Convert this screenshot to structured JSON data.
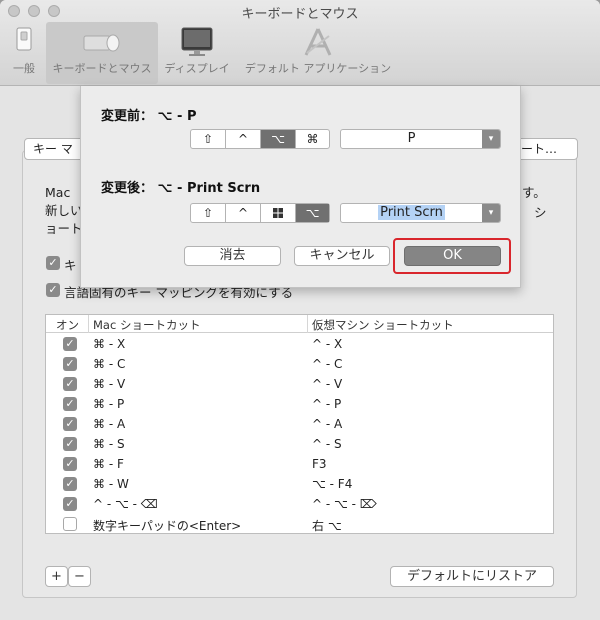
{
  "window": {
    "title": "キーボードとマウス"
  },
  "toolbar": {
    "items": [
      {
        "label": "一般"
      },
      {
        "label": "キーボードとマウス"
      },
      {
        "label": "ディスプレイ"
      },
      {
        "label": "デフォルト アプリケーション"
      }
    ]
  },
  "tabs": {
    "left_label": "キー マ",
    "right_label": "ート…"
  },
  "description": {
    "line1_left": "Mac",
    "line1_right": "す。",
    "line2_left": "新しい",
    "line2_right": "シ",
    "line3_left": "ョート"
  },
  "options": {
    "opt1_label": "キ",
    "opt2_label": "言語固有のキー マッピングを有効にする"
  },
  "table": {
    "headers": {
      "on": "オン",
      "mac": "Mac ショートカット",
      "vm": "仮想マシン ショートカット"
    },
    "rows": [
      {
        "on": true,
        "mac": "⌘ - X",
        "vm": "^ - X"
      },
      {
        "on": true,
        "mac": "⌘ - C",
        "vm": "^ - C"
      },
      {
        "on": true,
        "mac": "⌘ - V",
        "vm": "^ - V"
      },
      {
        "on": true,
        "mac": "⌘ - P",
        "vm": "^ - P"
      },
      {
        "on": true,
        "mac": "⌘ - A",
        "vm": "^ - A"
      },
      {
        "on": true,
        "mac": "⌘ - S",
        "vm": "^ - S"
      },
      {
        "on": true,
        "mac": "⌘ - F",
        "vm": "F3"
      },
      {
        "on": true,
        "mac": "⌘ - W",
        "vm": "⌥ - F4"
      },
      {
        "on": true,
        "mac": "^ - ⌥ - ⌫",
        "vm": "^ - ⌥ - ⌦"
      },
      {
        "on": false,
        "mac": "数字キーパッドの<Enter>",
        "vm": "右 ⌥"
      }
    ]
  },
  "footer": {
    "add": "+",
    "remove": "−",
    "restore_label": "デフォルトにリストア"
  },
  "sheet": {
    "before_label": "変更前：  ⌥ - P",
    "after_label": "変更後：  ⌥ - Print Scrn",
    "before_keys": [
      "⇧",
      "^",
      "⌥",
      "⌘"
    ],
    "after_keys": [
      "⇧",
      "^",
      "⊞",
      "⌥"
    ],
    "before_select": "P",
    "after_select": "Print Scrn",
    "clear_label": "消去",
    "cancel_label": "キャンセル",
    "ok_label": "OK"
  },
  "colors": {
    "highlight": "#d9262c",
    "selected_key": "#707070",
    "text_selection": "#b4d2f5"
  }
}
